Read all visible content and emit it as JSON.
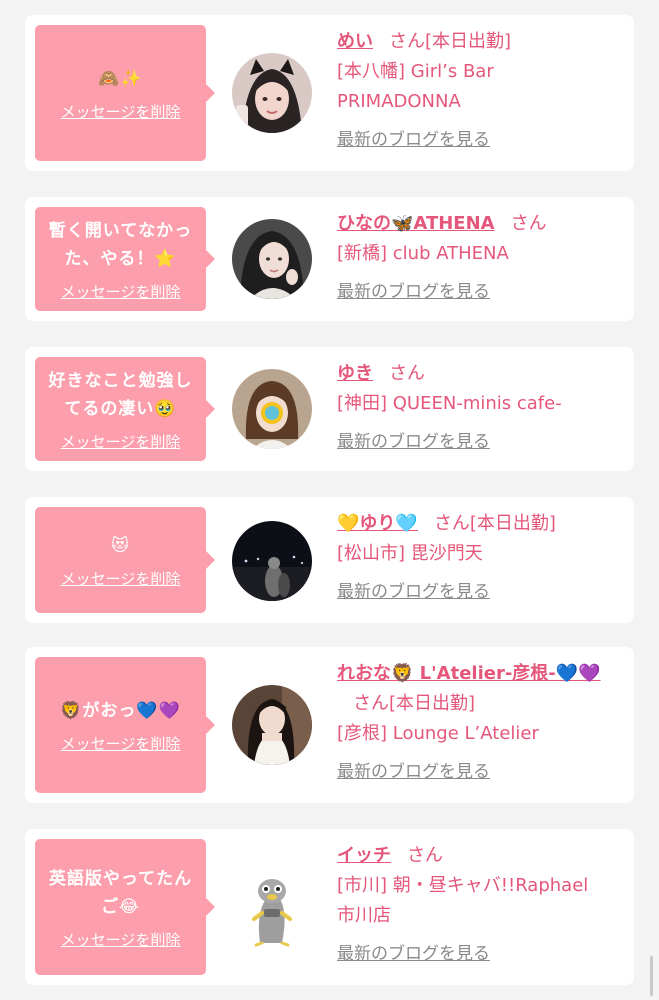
{
  "common": {
    "delete_label": "メッセージを削除",
    "blog_label": "最新のブログを見る",
    "san": "さん"
  },
  "cards": [
    {
      "message": "🙈✨",
      "name": "めい",
      "today": "[本日出勤]",
      "shop_lines": [
        "[本八幡] Girl’s Bar",
        "PRIMADONNA"
      ],
      "avatar": "girl-with-cat-ears-icon"
    },
    {
      "message": "暫く開いてなかった、やる！⭐",
      "name": "ひなの🦋ATHENA",
      "today": "",
      "shop_lines": [
        "[新橋] club ATHENA"
      ],
      "avatar": "girl-dark-hair-icon"
    },
    {
      "message": "好きなこと勉強してるの凄い🥹",
      "name": "ゆき",
      "today": "",
      "shop_lines": [
        "[神田] QUEEN-minis cafe-"
      ],
      "avatar": "girl-short-hair-icon"
    },
    {
      "message": "😻",
      "name": "💛ゆり🩵",
      "today": "[本日出勤]",
      "shop_lines": [
        "[松山市] 毘沙門天"
      ],
      "avatar": "night-scene-icon"
    },
    {
      "message": "🦁がおっ💙💜",
      "name": "れおな🦁 L'Atelier-彦根-💙💜",
      "today": "[本日出勤]",
      "shop_lines": [
        "[彦根] Lounge L’Atelier"
      ],
      "avatar": "girl-white-dress-icon"
    },
    {
      "message": "英語版やってたんご😂",
      "name": "イッチ",
      "today": "",
      "shop_lines": [
        "[市川] 朝・昼キャバ!!Raphael",
        "市川店"
      ],
      "avatar": "seal-mascot-icon"
    }
  ],
  "colors": {
    "background": "#f3f3f3",
    "bubble": "#fd9eac",
    "accent": "#e5577a",
    "link_gray": "#8a8a8a"
  }
}
